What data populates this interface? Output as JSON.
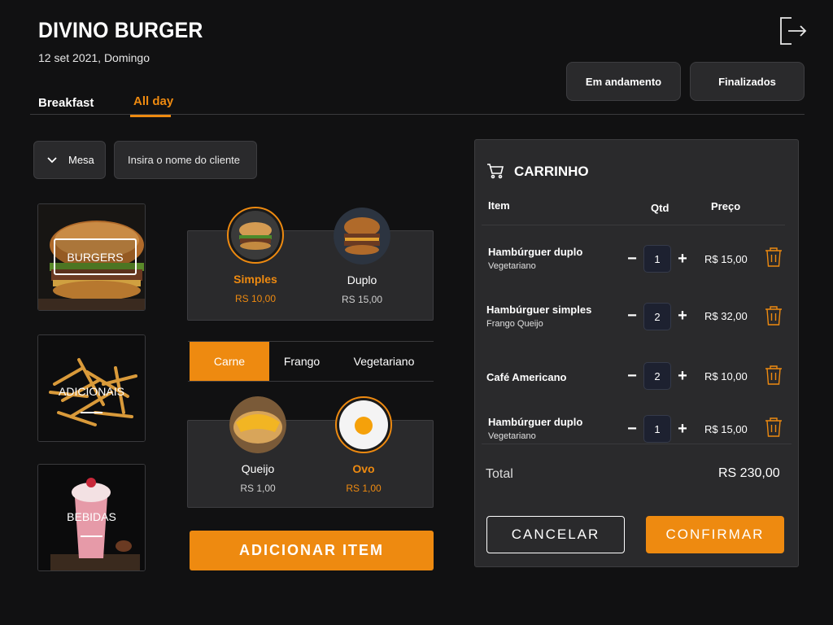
{
  "header": {
    "brand": "DIVINO BURGER",
    "date": "12 set 2021, Domingo",
    "status_buttons": [
      "Em andamento",
      "Finalizados"
    ]
  },
  "tabs": [
    {
      "label": "Breakfast",
      "active": false
    },
    {
      "label": "All day",
      "active": true
    }
  ],
  "filters": {
    "mesa_label": "Mesa",
    "client_placeholder": "Insira o nome do cliente"
  },
  "categories": [
    {
      "label": "BURGERS",
      "selected": true,
      "icon": "burger-image"
    },
    {
      "label": "ADICIONAIS",
      "selected": false,
      "icon": "fries-image"
    },
    {
      "label": "BEBIDAS",
      "selected": false,
      "icon": "milkshake-image"
    }
  ],
  "products": [
    {
      "name": "Simples",
      "price": "RS 10,00",
      "selected": true,
      "icon": "burger-simple-image"
    },
    {
      "name": "Duplo",
      "price": "RS 15,00",
      "selected": false,
      "icon": "burger-double-image"
    }
  ],
  "proteins": [
    {
      "label": "Carne",
      "active": true
    },
    {
      "label": "Frango",
      "active": false
    },
    {
      "label": "Vegetariano",
      "active": false
    }
  ],
  "extras": [
    {
      "name": "Queijo",
      "price": "RS 1,00",
      "selected": false,
      "icon": "cheese-image"
    },
    {
      "name": "Ovo",
      "price": "RS 1,00",
      "selected": true,
      "icon": "egg-image"
    }
  ],
  "add_item_label": "ADICIONAR ITEM",
  "cart": {
    "title": "CARRINHO",
    "columns": {
      "item": "Item",
      "qtd": "Qtd",
      "preco": "Preço"
    },
    "items": [
      {
        "name": "Hambúrguer duplo",
        "sub": "Vegetariano",
        "qty": "1",
        "price": "R$ 15,00"
      },
      {
        "name": "Hambúrguer simples",
        "sub": "Frango Queijo",
        "qty": "2",
        "price": "R$ 32,00"
      },
      {
        "name": "Café Americano",
        "sub": "",
        "qty": "2",
        "price": "R$ 10,00"
      },
      {
        "name": "Hambúrguer duplo",
        "sub": "Vegetariano",
        "qty": "1",
        "price": "R$ 15,00"
      }
    ],
    "total_label": "Total",
    "total_value": "RS 230,00",
    "cancel_label": "CANCELAR",
    "confirm_label": "CONFIRMAR"
  },
  "colors": {
    "accent": "#ee8a10",
    "background": "#111112",
    "panel": "#2a2a2c"
  }
}
